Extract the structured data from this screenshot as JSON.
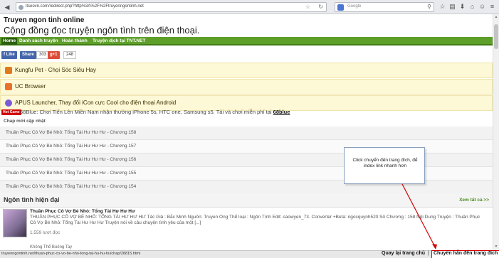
{
  "browser": {
    "url": "itseovn.com/redirect.php?http%3A%2F%2Ftruyenngontinh.net",
    "search_placeholder": "Google"
  },
  "site": {
    "name": "Truyen ngon tinh online",
    "tagline": "Cộng đồng đọc truyện ngôn tình trên điện thoại."
  },
  "nav": [
    "Home",
    "Danh sách truyện",
    "Hoàn thành",
    "Truyện dịch tại TNT.NET"
  ],
  "social": {
    "like_label": "Like",
    "share_label": "Share",
    "share_count": "303",
    "gplus_label": "+1",
    "gplus_count": "248"
  },
  "promos": [
    {
      "text": "Kungfu Pet - Chọi Sóc Siêu Hay",
      "icon": "kungfu-pet-icon",
      "color": "#e07a1f"
    },
    {
      "text": "UC Browser",
      "icon": "uc-browser-icon",
      "color": "#e8722a"
    },
    {
      "text": "APUS Launcher, Thay đổi iCon cực Cool cho điện thoại Android",
      "icon": "apus-launcher-icon",
      "color": "#7a5bd6"
    }
  ],
  "hot": {
    "badge": "Hot Game",
    "text": "68Blue: Chơi Tiến Lên Miền Nam nhận thưởng iPhone 5s, HTC one, Samsung s5. Tải và chơi miễn phí tại",
    "link": "68blue"
  },
  "updates": {
    "title": "Chap mới cập nhật",
    "items": [
      "Thuần Phục Cô Vợ Bé Nhỏ: Tổng Tài Hư Hư Hư - Chương 158",
      "Thuần Phục Cô Vợ Bé Nhỏ: Tổng Tài Hư Hư Hư - Chương 157",
      "Thuần Phục Cô Vợ Bé Nhỏ: Tổng Tài Hư Hư Hư - Chương 156",
      "Thuần Phục Cô Vợ Bé Nhỏ: Tổng Tài Hư Hư Hư - Chương 155",
      "Thuần Phục Cô Vợ Bé Nhỏ: Tổng Tài Hư Hư Hư - Chương 154"
    ]
  },
  "section": {
    "title": "Ngôn tình hiện đại",
    "see_all": "Xem tất cả >>"
  },
  "story": {
    "title": "Thuần Phục Cô Vợ Bé Nhỏ: Tổng Tài Hư Hư Hư",
    "description": "THUẦN PHỤC CÔ VỢ BÉ NHỎ: TỔNG TÀI HƯ HƯ HƯ Tác Giả : Bắc Minh Nguồn: Truyen Ong Thể loại : Ngôn Tình Edit: caowyen_73. Converter +Beta: ngocquynh520 Số Chương : 158 Nội Dung Truyện : Thuần Phục Cô Vợ Bé Nhỏ: Tổng Tài Hư Hư Hư Truyện nói về câu chuyện tình yêu của một [...]",
    "views": "1,559 lượt đọc",
    "next_title": "Không Thể Buông Tay"
  },
  "callout": "Click chuyển đến trang đích, để index link nhanh hơn",
  "status": {
    "url": "truyenngontinh.net/thuan-phuc-co-vo-be-nho-tong-tai-hu-hu-hu/chap/28815.html",
    "back_home": "Quay lại trang chủ",
    "separator": "|",
    "go_destination": "Chuyển hẳn đến trang đích"
  }
}
